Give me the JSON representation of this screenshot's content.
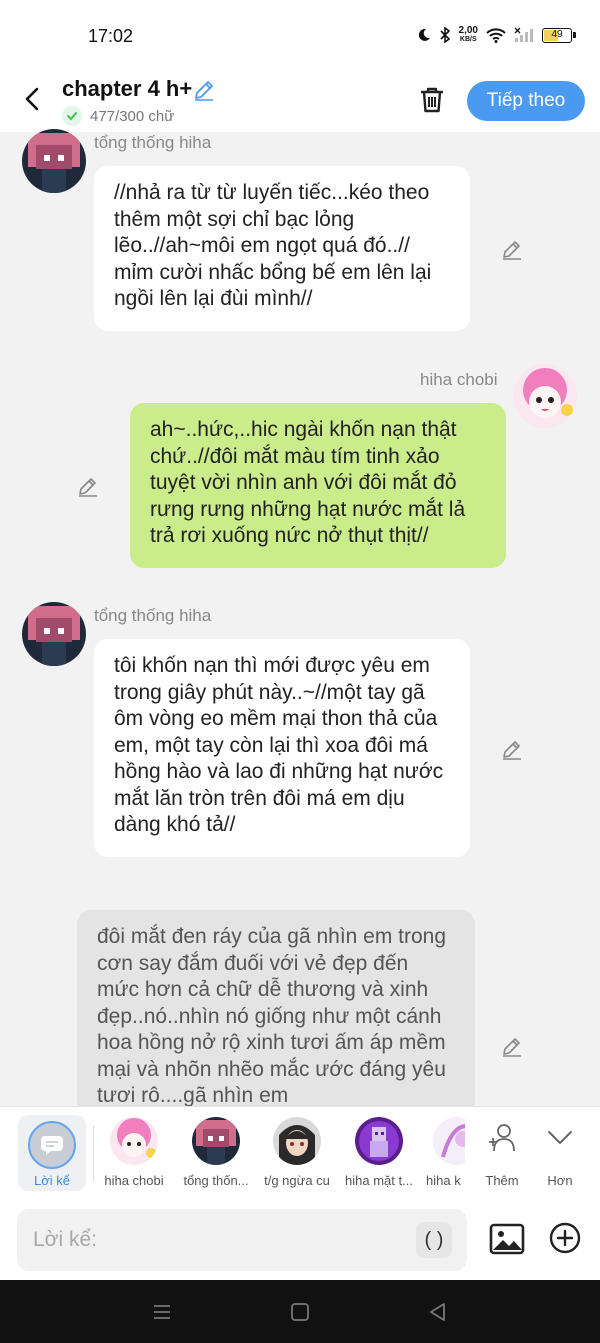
{
  "status_bar": {
    "time": "17:02",
    "net_speed_value": "2,00",
    "net_speed_unit": "KB/S",
    "battery_level": "49",
    "icons": [
      "moon-icon",
      "bluetooth-icon",
      "wifi-icon",
      "signal-icon",
      "battery-icon"
    ]
  },
  "header": {
    "title": "chapter 4 h+",
    "word_count": "477/300 chữ",
    "next_label": "Tiếp theo",
    "icons": [
      "back-arrow-icon",
      "pencil-icon",
      "check-icon",
      "trash-icon"
    ]
  },
  "messages": [
    {
      "sender": "tổng thống hiha",
      "side": "left",
      "style": "white",
      "text": "//nhả ra từ từ luyến tiếc...kéo theo thêm một sợi chỉ bạc lỏng lẽo..//ah~môi em ngọt quá đó..// mỉm cười nhấc bổng bế em lên lại ngồi lên lại đùi mình//"
    },
    {
      "sender": "hiha chobi",
      "side": "right",
      "style": "green",
      "text": "ah~..hức,..hic ngài khốn nạn thật chứ..//đôi mắt màu tím tinh xảo tuyệt vời nhìn anh với đôi mắt đỏ rưng rưng những hạt nước mắt lả trả rơi xuống nức nở thụt thịt//"
    },
    {
      "sender": "tổng thống hiha",
      "side": "left",
      "style": "white",
      "text": "tôi khốn nạn thì mới được yêu em trong giây phút này..~//một tay gã ôm vòng eo mềm mại thon thả của em, một tay còn lại thì xoa đôi má hồng hào và lao đi những hạt nước mắt lăn tròn trên đôi má em dịu dàng khó tả//"
    },
    {
      "sender": "",
      "side": "narration",
      "style": "gray",
      "text": "đôi mắt đen ráy của gã nhìn em trong cơn say đắm đuối với vẻ đẹp đến mức hơn cả chữ dễ thương và xinh đẹp..nó..nhìn nó giống như một cánh hoa hồng nở rộ xinh tươi ấm áp mềm mại và nhõn nhẽo mắc ước đáng yêu tươi rô....gã nhìn em"
    }
  ],
  "character_bar": {
    "narration_label": "Lời kể",
    "characters": [
      {
        "label": "hiha chobi"
      },
      {
        "label": "tổng thốn..."
      },
      {
        "label": "t/g ngừa cu"
      },
      {
        "label": "hiha mặt t..."
      },
      {
        "label": "hiha k"
      }
    ],
    "add_label": "Thêm",
    "more_label": "Hơn"
  },
  "input": {
    "placeholder": "Lời kể:",
    "paren_label": "( )"
  },
  "colors": {
    "accent": "#4a9af2",
    "green_bubble": "#cbec8a",
    "white_bubble": "#ffffff",
    "narration_bubble": "#e4e4e4",
    "background": "#f2f2f2"
  }
}
